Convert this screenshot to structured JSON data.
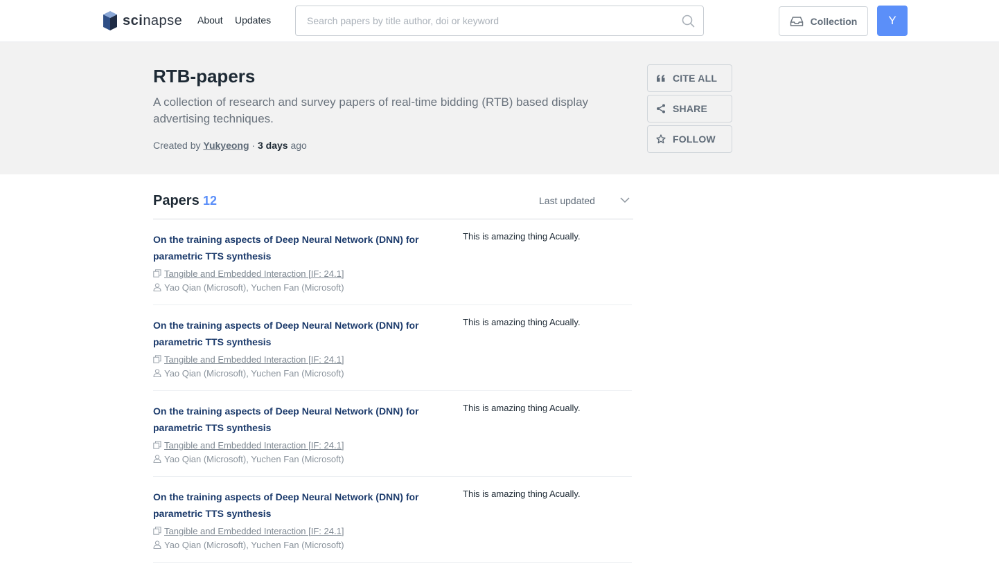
{
  "header": {
    "logo": {
      "bold": "sci",
      "regular": "napse"
    },
    "nav": [
      {
        "label": "About"
      },
      {
        "label": "Updates"
      }
    ],
    "search": {
      "placeholder": "Search papers by title author, doi or keyword",
      "value": ""
    },
    "collection_label": "Collection",
    "avatar_initial": "Y"
  },
  "collection": {
    "title": "RTB-papers",
    "description": "A collection of research and survey papers of real-time bidding (RTB) based display advertising techniques.",
    "created_by_prefix": "Created by",
    "author": "Yukyeong",
    "separator": "·",
    "age": "3 days",
    "age_suffix": "ago",
    "actions": [
      {
        "label": "CITE ALL"
      },
      {
        "label": "SHARE"
      },
      {
        "label": "FOLLOW"
      }
    ]
  },
  "papers": {
    "heading": "Papers",
    "count": "12",
    "sort_label": "Last updated",
    "items": [
      {
        "title": "On the training aspects of Deep Neural Network (DNN) for parametric TTS synthesis",
        "venue": "Tangible and Embedded Interaction [IF: 24.1]",
        "authors": "Yao Qian (Microsoft), Yuchen Fan (Microsoft)",
        "note": "This is amazing thing Acually."
      },
      {
        "title": "On the training aspects of Deep Neural Network (DNN) for parametric TTS synthesis",
        "venue": "Tangible and Embedded Interaction [IF: 24.1]",
        "authors": "Yao Qian (Microsoft), Yuchen Fan (Microsoft)",
        "note": "This is amazing thing Acually."
      },
      {
        "title": "On the training aspects of Deep Neural Network (DNN) for parametric TTS synthesis",
        "venue": "Tangible and Embedded Interaction [IF: 24.1]",
        "authors": "Yao Qian (Microsoft), Yuchen Fan (Microsoft)",
        "note": "This is amazing thing Acually."
      },
      {
        "title": "On the training aspects of Deep Neural Network (DNN) for parametric TTS synthesis",
        "venue": "Tangible and Embedded Interaction [IF: 24.1]",
        "authors": "Yao Qian (Microsoft), Yuchen Fan (Microsoft)",
        "note": "This is amazing thing Acually."
      }
    ]
  },
  "colors": {
    "accent": "#5b8ff9",
    "paper_title": "#1b3a6b",
    "hero_bg": "#f2f2f2"
  },
  "icons": [
    "logo-cube-icon",
    "search-icon",
    "inbox-icon",
    "quote-icon",
    "share-icon",
    "star-icon",
    "chevron-down-icon",
    "copy-icon",
    "user-icon"
  ]
}
